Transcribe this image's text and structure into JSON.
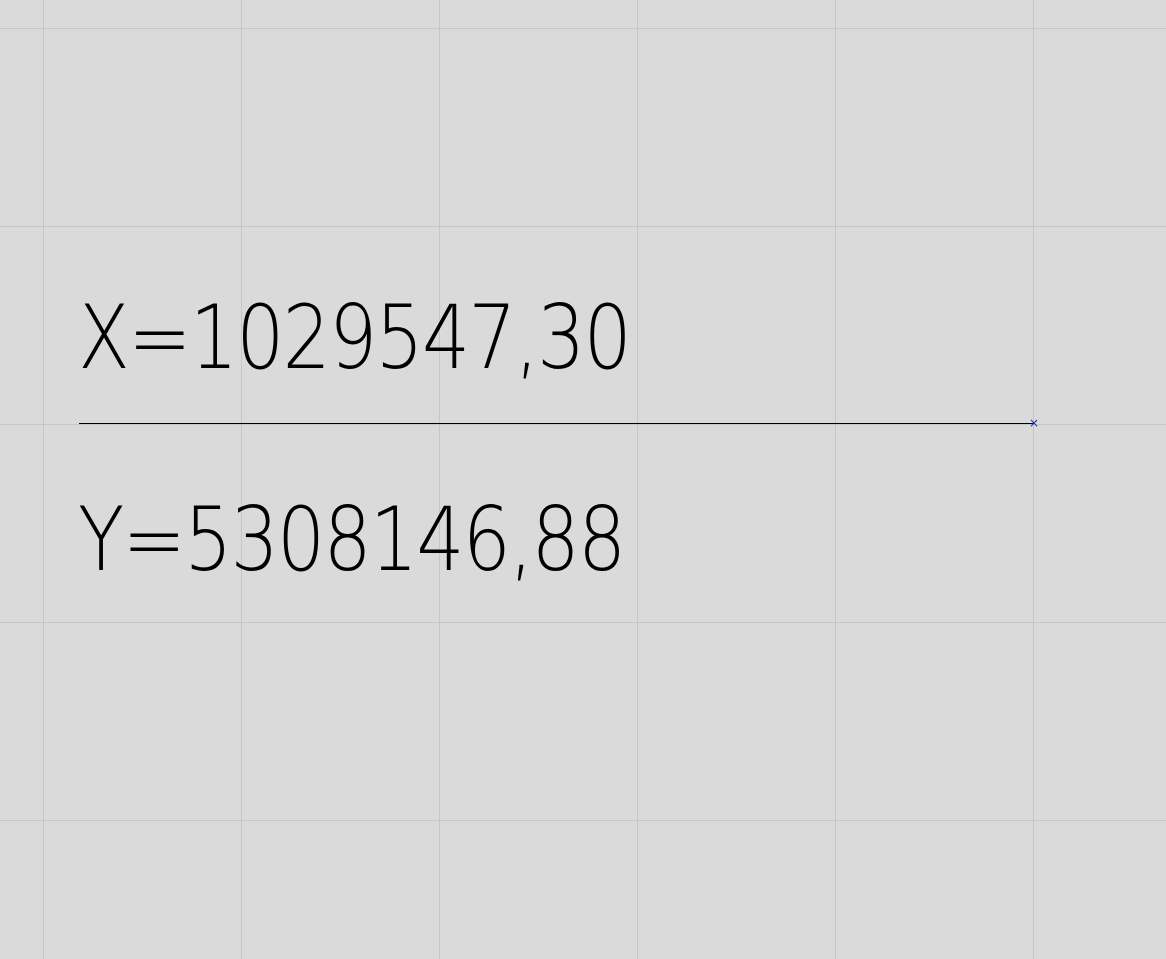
{
  "drawing": {
    "x_label": "X=1029547,30",
    "y_label": "Y=5308146,88"
  },
  "marker": {
    "icon": "cross-marker-icon",
    "glyph": "×",
    "color": "#1a2db0"
  },
  "colors": {
    "background": "#dadada",
    "grid": "#c6c6c6",
    "text": "#000000"
  }
}
